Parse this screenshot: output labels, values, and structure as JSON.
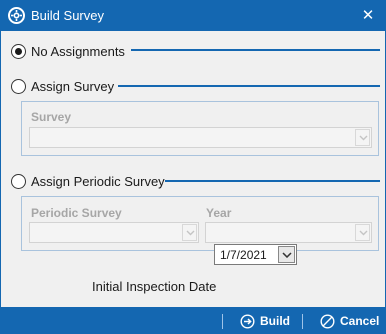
{
  "window": {
    "title": "Build Survey",
    "title_icon": "survey-gear-icon",
    "close_glyph": "✕"
  },
  "options": {
    "no_assignments": {
      "label": "No Assignments",
      "checked": true
    },
    "assign_survey": {
      "label": "Assign Survey",
      "checked": false
    },
    "assign_periodic": {
      "label": "Assign Periodic Survey",
      "checked": false
    }
  },
  "survey_group": {
    "survey_label": "Survey",
    "survey_value": ""
  },
  "periodic_group": {
    "periodic_label": "Periodic Survey",
    "periodic_value": "",
    "year_label": "Year",
    "year_value": ""
  },
  "inspection": {
    "label": "Initial Inspection Date",
    "value": "1/7/2021"
  },
  "footer": {
    "build_label": "Build",
    "build_icon": "arrow-right-circle-icon",
    "cancel_label": "Cancel",
    "cancel_icon": "cancel-circle-icon"
  },
  "colors": {
    "accent": "#1467b1",
    "client_bg": "#f0f0f0",
    "group_border": "#a9c3dd",
    "disabled_text": "#a6a6a6"
  }
}
